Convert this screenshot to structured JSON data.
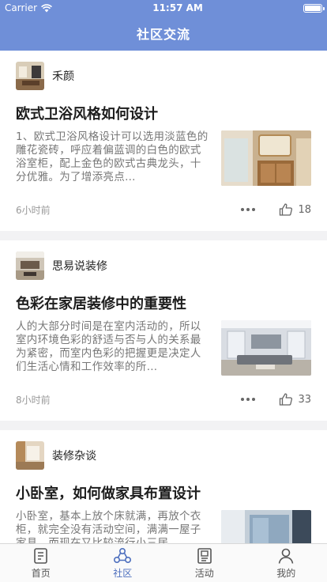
{
  "status": {
    "carrier": "Carrier",
    "time": "11:57 AM"
  },
  "nav": {
    "title": "社区交流"
  },
  "posts": [
    {
      "author": "禾颜",
      "title": "欧式卫浴风格如何设计",
      "excerpt": "1、欧式卫浴风格设计可以选用淡蓝色的雕花瓷砖，呼应着偏蓝调的白色的欧式浴室柜，配上金色的欧式古典龙头，十分优雅。为了增添亮点…",
      "time": "6小时前",
      "likes": "18"
    },
    {
      "author": "思易说装修",
      "title": "色彩在家居装修中的重要性",
      "excerpt": "人的大部分时间是在室内活动的，所以室内环境色彩的舒适与否与人的关系最为紧密，而室内色彩的把握更是决定人们生活心情和工作效率的所…",
      "time": "8小时前",
      "likes": "33"
    },
    {
      "author": "装修杂谈",
      "title": "小卧室，如何做家具布置设计",
      "excerpt": "小卧室，基本上放个床就满，再放个衣柜，就完全没有活动空间，满满一屋子家具，而现在又比较流行小三居…",
      "time": "",
      "likes": ""
    }
  ],
  "tabs": [
    {
      "label": "首页",
      "icon": "book-icon"
    },
    {
      "label": "社区",
      "icon": "community-icon"
    },
    {
      "label": "活动",
      "icon": "clipboard-icon"
    },
    {
      "label": "我的",
      "icon": "user-icon"
    }
  ],
  "colors": {
    "accent": "#6f8fd8",
    "tab_active": "#4d6fbe"
  }
}
